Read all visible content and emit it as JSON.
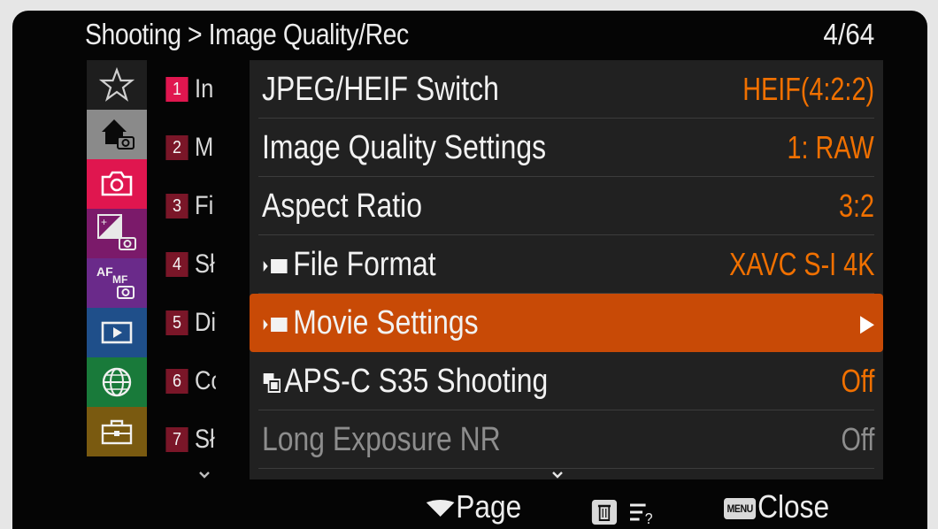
{
  "header": {
    "breadcrumb": "Shooting > Image Quality/Rec",
    "page_count": "4/64"
  },
  "category_tabs": [
    {
      "icon": "star-icon",
      "bg": "#1e1e1e",
      "active": false
    },
    {
      "icon": "home-camera-icon",
      "bg": "#8a8a8a",
      "active": false
    },
    {
      "icon": "camera-icon",
      "bg": "#e0164f",
      "active": true
    },
    {
      "icon": "exposure-icon",
      "bg": "#7b1a6a",
      "active": false
    },
    {
      "icon": "af-mf-icon",
      "bg": "#6a2a8a",
      "active": false
    },
    {
      "icon": "playback-icon",
      "bg": "#1f4f8a",
      "active": false
    },
    {
      "icon": "globe-icon",
      "bg": "#197a3a",
      "active": false
    },
    {
      "icon": "toolbox-icon",
      "bg": "#7a5a10",
      "active": false
    }
  ],
  "subgroups": [
    {
      "num": "1",
      "text": "In",
      "active": true
    },
    {
      "num": "2",
      "text": "M",
      "active": false
    },
    {
      "num": "3",
      "text": "Fi",
      "active": false
    },
    {
      "num": "4",
      "text": "Sł",
      "active": false
    },
    {
      "num": "5",
      "text": "Di",
      "active": false
    },
    {
      "num": "6",
      "text": "Cc",
      "active": false
    },
    {
      "num": "7",
      "text": "Sł",
      "active": false
    }
  ],
  "menu_items": [
    {
      "label": "JPEG/HEIF Switch",
      "value": "HEIF(4:2:2)",
      "movie_icon": false,
      "selected": false,
      "dimmed": false
    },
    {
      "label": "Image Quality Settings",
      "value": "1: RAW",
      "movie_icon": false,
      "selected": false,
      "dimmed": false
    },
    {
      "label": "Aspect Ratio",
      "value": "3:2",
      "movie_icon": false,
      "selected": false,
      "dimmed": false
    },
    {
      "label": "File Format",
      "value": "XAVC S-I 4K",
      "movie_icon": true,
      "selected": false,
      "dimmed": false
    },
    {
      "label": "Movie Settings",
      "value": "▶",
      "movie_icon": true,
      "selected": true,
      "dimmed": false
    },
    {
      "label": "APS-C S35 Shooting",
      "value": "Off",
      "movie_icon": false,
      "selected": false,
      "dimmed": false
    },
    {
      "label": "Long Exposure NR",
      "value": "Off",
      "movie_icon": false,
      "selected": false,
      "dimmed": true
    }
  ],
  "footer": {
    "page_hint": "Page",
    "delete_key": "delete-icon",
    "help_icon": "help-list-icon",
    "menu_key": "MENU",
    "close_label": "Close"
  },
  "colors": {
    "accent_orange": "#f07000",
    "selection": "#c84a06",
    "active_number": "#e0164f",
    "inactive_number": "#7a1628"
  }
}
